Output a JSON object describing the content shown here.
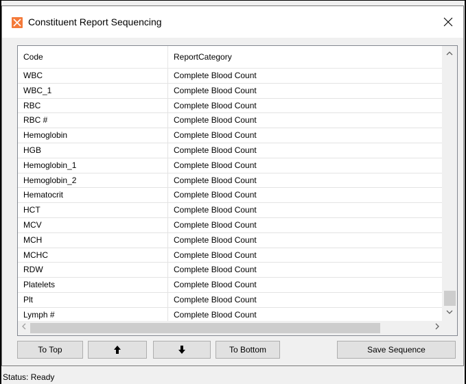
{
  "window": {
    "title": "Constituent Report Sequencing",
    "close_glyph": "✕",
    "icon": "app-logo-icon",
    "accent": "#f47a3a"
  },
  "grid": {
    "columns": [
      "Code",
      "ReportCategory"
    ],
    "rows": [
      [
        "WBC",
        "Complete Blood Count"
      ],
      [
        "WBC_1",
        "Complete Blood Count"
      ],
      [
        "RBC",
        "Complete Blood Count"
      ],
      [
        "RBC #",
        "Complete Blood Count"
      ],
      [
        "Hemoglobin",
        "Complete Blood Count"
      ],
      [
        "HGB",
        "Complete Blood Count"
      ],
      [
        "Hemoglobin_1",
        "Complete Blood Count"
      ],
      [
        "Hemoglobin_2",
        "Complete Blood Count"
      ],
      [
        "Hematocrit",
        "Complete Blood Count"
      ],
      [
        "HCT",
        "Complete Blood Count"
      ],
      [
        "MCV",
        "Complete Blood Count"
      ],
      [
        "MCH",
        "Complete Blood Count"
      ],
      [
        "MCHC",
        "Complete Blood Count"
      ],
      [
        "RDW",
        "Complete Blood Count"
      ],
      [
        "Platelets",
        "Complete Blood Count"
      ],
      [
        "Plt",
        "Complete Blood Count"
      ],
      [
        "Lymph #",
        "Complete Blood Count"
      ]
    ]
  },
  "buttons": {
    "to_top": "To Top",
    "move_up": "🡅",
    "move_down": "🡇",
    "to_bottom": "To Bottom",
    "save_sequence": "Save Sequence"
  },
  "status": {
    "text": "Status: Ready"
  }
}
